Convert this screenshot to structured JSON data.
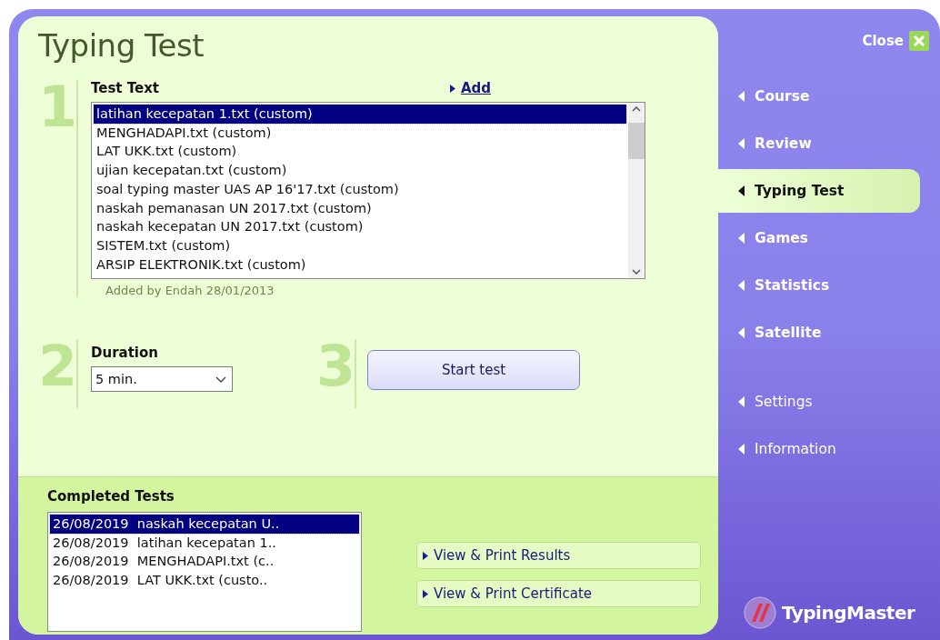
{
  "window": {
    "title": "Typing Test"
  },
  "close": {
    "label": "Close"
  },
  "step1": {
    "number": "1",
    "label": "Test Text",
    "add_link": "Add",
    "note": "Added by Endah 28/01/2013",
    "items": [
      {
        "text": "latihan kecepatan 1.txt (custom)",
        "selected": true
      },
      {
        "text": "MENGHADAPI.txt (custom)",
        "selected": false
      },
      {
        "text": "LAT UKK.txt (custom)",
        "selected": false
      },
      {
        "text": "ujian kecepatan.txt (custom)",
        "selected": false
      },
      {
        "text": "soal typing master UAS AP 16'17.txt (custom)",
        "selected": false
      },
      {
        "text": "naskah pemanasan UN 2017.txt (custom)",
        "selected": false
      },
      {
        "text": "naskah kecepatan UN 2017.txt (custom)",
        "selected": false
      },
      {
        "text": "SISTEM.txt (custom)",
        "selected": false
      },
      {
        "text": "ARSIP ELEKTRONIK.txt (custom)",
        "selected": false
      }
    ]
  },
  "step2": {
    "number": "2",
    "label": "Duration",
    "value": "5 min."
  },
  "step3": {
    "number": "3",
    "button": "Start test"
  },
  "completed_tests": {
    "label": "Completed Tests",
    "rows": [
      {
        "date": "26/08/2019",
        "name": "naskah kecepatan U..",
        "selected": true
      },
      {
        "date": "26/08/2019",
        "name": "latihan kecepatan 1..",
        "selected": false
      },
      {
        "date": "26/08/2019",
        "name": "MENGHADAPI.txt (c..",
        "selected": false
      },
      {
        "date": "26/08/2019",
        "name": "LAT UKK.txt (custo..",
        "selected": false
      }
    ],
    "actions": [
      "View & Print Results",
      "View & Print Certificate"
    ]
  },
  "sidebar": {
    "items": [
      {
        "label": "Course",
        "kind": "primary",
        "selected": false
      },
      {
        "label": "Review",
        "kind": "primary",
        "selected": false
      },
      {
        "label": "Typing Test",
        "kind": "primary",
        "selected": true
      },
      {
        "label": "Games",
        "kind": "primary",
        "selected": false
      },
      {
        "label": "Statistics",
        "kind": "primary",
        "selected": false
      },
      {
        "label": "Satellite",
        "kind": "primary",
        "selected": false
      },
      {
        "label": "Settings",
        "kind": "secondary",
        "selected": false
      },
      {
        "label": "Information",
        "kind": "secondary",
        "selected": false
      }
    ],
    "logo": "TypingMaster"
  }
}
